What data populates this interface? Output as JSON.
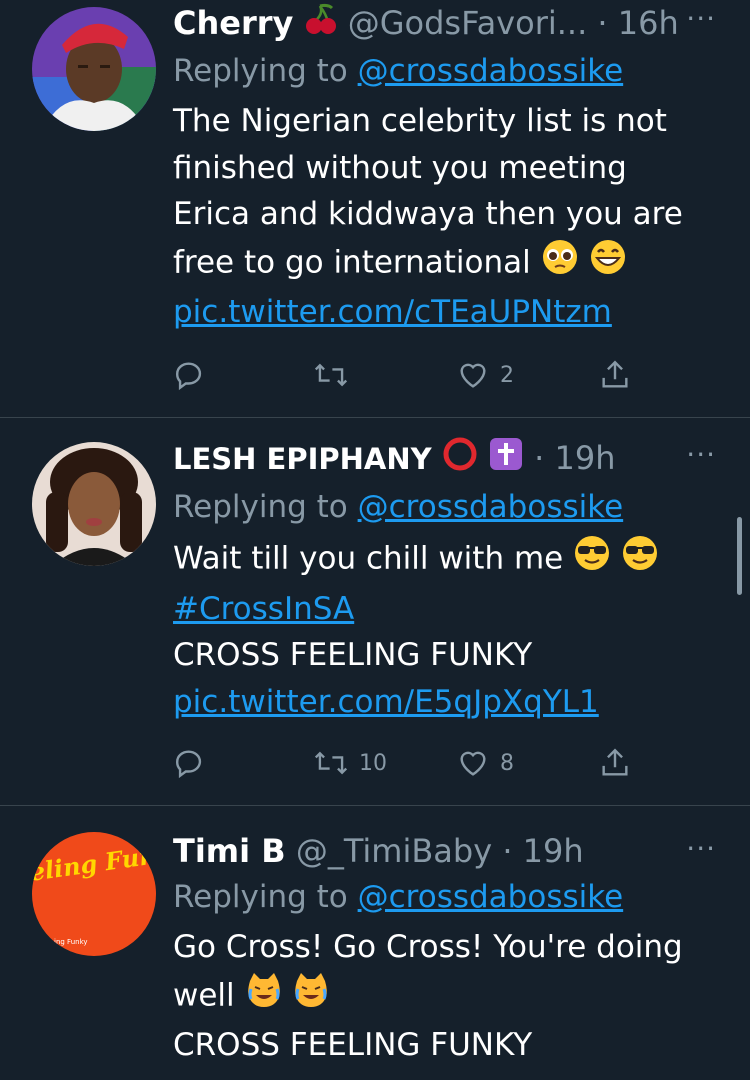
{
  "tweets": [
    {
      "name": "Cherry",
      "handle": "@GodsFavori...",
      "time": "· 16h",
      "more": "···",
      "replying_prefix": "Replying to ",
      "replying_to": "@crossdabossike",
      "body_lines": [
        "The Nigerian celebrity list is not",
        "finished without you meeting",
        "Erica and kiddwaya then you are",
        "free to go international"
      ],
      "link": "pic.twitter.com/cTEaUPNtzm",
      "reply_count": "",
      "retweet_count": "",
      "like_count": "2"
    },
    {
      "name": "LESH EPIPHANY",
      "handle": "",
      "time": "· 19h",
      "more": "···",
      "replying_prefix": "Replying to ",
      "replying_to": "@crossdabossike",
      "body_lines": [
        "Wait till you chill with me"
      ],
      "hashtag": "#CrossInSA",
      "body_after": "CROSS FEELING FUNKY",
      "link": "pic.twitter.com/E5qJpXqYL1",
      "reply_count": "",
      "retweet_count": "10",
      "like_count": "8"
    },
    {
      "name": "Timi B",
      "handle": "@_TimiBaby",
      "time": "· 19h",
      "more": "···",
      "replying_prefix": "Replying to ",
      "replying_to": "@crossdabossike",
      "body_lines": [
        "Go Cross! Go Cross! You're doing",
        "well"
      ],
      "body_after": "CROSS FEELING FUNKY",
      "avatar_text": "Feeling Funky",
      "avatar_small_text": "ing Funky"
    }
  ],
  "colors": {
    "background": "#15202b",
    "secondary_text": "#8899a6",
    "link": "#1d9bf0",
    "divider": "#38444d"
  },
  "icons": [
    "reply-icon",
    "retweet-icon",
    "like-icon",
    "share-icon",
    "more-icon",
    "cherry-emoji",
    "pleading-face-emoji",
    "grinning-face-emoji",
    "red-circle-emoji",
    "latin-cross-emoji",
    "sunglasses-emoji",
    "crying-laughing-cat-emoji"
  ]
}
